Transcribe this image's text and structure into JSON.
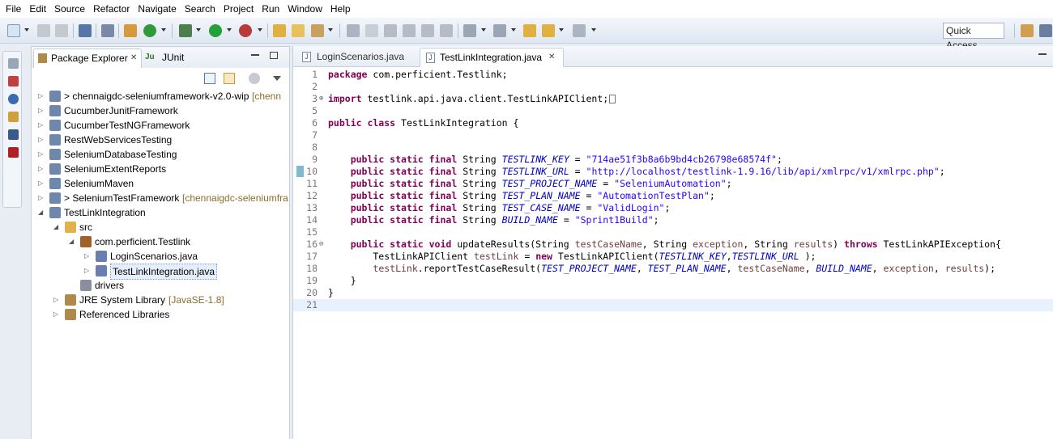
{
  "menu": [
    "File",
    "Edit",
    "Source",
    "Refactor",
    "Navigate",
    "Search",
    "Project",
    "Run",
    "Window",
    "Help"
  ],
  "toolbar": {
    "quick_access": "Quick Access"
  },
  "package_explorer": {
    "tab_label": "Package Explorer",
    "junit_tab_label": "JUnit",
    "tree": [
      {
        "label": "> chennaigdc-seleniumframework-v2.0-wip",
        "decoration": "[chenn",
        "indent": 0,
        "twisty": "closed"
      },
      {
        "label": "CucumberJunitFramework",
        "decoration": "",
        "indent": 0,
        "twisty": "closed"
      },
      {
        "label": "CucumberTestNGFramework",
        "decoration": "",
        "indent": 0,
        "twisty": "closed"
      },
      {
        "label": "RestWebServicesTesting",
        "decoration": "",
        "indent": 0,
        "twisty": "closed"
      },
      {
        "label": "SeleniumDatabaseTesting",
        "decoration": "",
        "indent": 0,
        "twisty": "closed"
      },
      {
        "label": "SeleniumExtentReports",
        "decoration": "",
        "indent": 0,
        "twisty": "closed"
      },
      {
        "label": "SeleniumMaven",
        "decoration": "",
        "indent": 0,
        "twisty": "closed"
      },
      {
        "label": "> SeleniumTestFramework",
        "decoration": "[chennaigdc-seleniumfra",
        "indent": 0,
        "twisty": "closed"
      },
      {
        "label": "TestLinkIntegration",
        "decoration": "",
        "indent": 0,
        "twisty": "open"
      },
      {
        "label": "src",
        "decoration": "",
        "indent": 1,
        "twisty": "open"
      },
      {
        "label": "com.perficient.Testlink",
        "decoration": "",
        "indent": 2,
        "twisty": "open"
      },
      {
        "label": "LoginScenarios.java",
        "decoration": "",
        "indent": 3,
        "twisty": "closed"
      },
      {
        "label": "TestLinkIntegration.java",
        "decoration": "",
        "indent": 3,
        "twisty": "closed"
      },
      {
        "label": "drivers",
        "decoration": "",
        "indent": 2,
        "twisty": "none"
      },
      {
        "label": "JRE System Library",
        "decoration": "[JavaSE-1.8]",
        "indent": 1,
        "twisty": "closed"
      },
      {
        "label": "Referenced Libraries",
        "decoration": "",
        "indent": 1,
        "twisty": "closed"
      }
    ]
  },
  "editor": {
    "tabs": [
      "LoginScenarios.java",
      "TestLinkIntegration.java"
    ],
    "line_numbers": [
      "1",
      "2",
      "3",
      "5",
      "6",
      "7",
      "8",
      "9",
      "10",
      "11",
      "12",
      "13",
      "14",
      "15",
      "16",
      "17",
      "18",
      "19",
      "20",
      "21"
    ],
    "lines": [
      {
        "n": "1",
        "parts": [
          [
            "kw",
            "package"
          ],
          [
            "",
            "com.perficient.Testlink;"
          ]
        ]
      },
      {
        "n": "2",
        "parts": []
      },
      {
        "n": "3",
        "parts": [
          [
            "kw",
            "import"
          ],
          [
            "",
            " testlink.api.java.client.TestLinkAPIClient;"
          ]
        ]
      },
      {
        "n": "5",
        "parts": []
      },
      {
        "n": "6",
        "parts": [
          [
            "kw",
            "public class"
          ],
          [
            "",
            " TestLinkIntegration {"
          ]
        ]
      },
      {
        "n": "7",
        "parts": []
      },
      {
        "n": "8",
        "parts": []
      },
      {
        "n": "9",
        "parts": [
          [
            "",
            "    "
          ],
          [
            "kw",
            "public static final"
          ],
          [
            "",
            " String "
          ],
          [
            "fld",
            "TESTLINK_KEY"
          ],
          [
            "",
            " = "
          ],
          [
            "str",
            "\"714ae51f3b8a6b9bd4cb26798e68574f\""
          ],
          [
            "",
            ";"
          ]
        ]
      },
      {
        "n": "10",
        "parts": [
          [
            "",
            "    "
          ],
          [
            "kw",
            "public static final"
          ],
          [
            "",
            " String "
          ],
          [
            "fld",
            "TESTLINK_URL"
          ],
          [
            "",
            " = "
          ],
          [
            "str",
            "\"http://localhost/testlink-1.9.16/lib/api/xmlrpc/v1/xmlrpc.php\""
          ],
          [
            "",
            ";"
          ]
        ]
      },
      {
        "n": "11",
        "parts": [
          [
            "",
            "    "
          ],
          [
            "kw",
            "public static final"
          ],
          [
            "",
            " String "
          ],
          [
            "fld",
            "TEST_PROJECT_NAME"
          ],
          [
            "",
            " = "
          ],
          [
            "str",
            "\"SeleniumAutomation\""
          ],
          [
            "",
            ";"
          ]
        ]
      },
      {
        "n": "12",
        "parts": [
          [
            "",
            "    "
          ],
          [
            "kw",
            "public static final"
          ],
          [
            "",
            " String "
          ],
          [
            "fld",
            "TEST_PLAN_NAME"
          ],
          [
            "",
            " = "
          ],
          [
            "str",
            "\"AutomationTestPlan\""
          ],
          [
            "",
            ";"
          ]
        ]
      },
      {
        "n": "13",
        "parts": [
          [
            "",
            "    "
          ],
          [
            "kw",
            "public static final"
          ],
          [
            "",
            " String "
          ],
          [
            "fld",
            "TEST_CASE_NAME"
          ],
          [
            "",
            " = "
          ],
          [
            "str",
            "\"ValidLogin\""
          ],
          [
            "",
            ";"
          ]
        ]
      },
      {
        "n": "14",
        "parts": [
          [
            "",
            "    "
          ],
          [
            "kw",
            "public static final"
          ],
          [
            "",
            " String "
          ],
          [
            "fld",
            "BUILD_NAME"
          ],
          [
            "",
            " = "
          ],
          [
            "str",
            "\"Sprint1Build\""
          ],
          [
            "",
            ";"
          ]
        ]
      },
      {
        "n": "15",
        "parts": []
      },
      {
        "n": "16",
        "parts": [
          [
            "",
            "    "
          ],
          [
            "kw",
            "public static void"
          ],
          [
            "",
            " updateResults(String "
          ],
          [
            "lvar",
            "testCaseName"
          ],
          [
            "",
            ", String "
          ],
          [
            "lvar",
            "exception"
          ],
          [
            "",
            ", String "
          ],
          [
            "lvar",
            "results"
          ],
          [
            "",
            ") "
          ],
          [
            "kw",
            "throws"
          ],
          [
            "",
            " TestLinkAPIException{"
          ]
        ]
      },
      {
        "n": "17",
        "parts": [
          [
            "",
            "        TestLinkAPIClient "
          ],
          [
            "lvar",
            "testLink"
          ],
          [
            "",
            " = "
          ],
          [
            "kw",
            "new"
          ],
          [
            "",
            " TestLinkAPIClient("
          ],
          [
            "fld",
            "TESTLINK_KEY"
          ],
          [
            "",
            ","
          ],
          [
            "fld",
            "TESTLINK_URL"
          ],
          [
            "",
            " );"
          ]
        ]
      },
      {
        "n": "18",
        "parts": [
          [
            "",
            "        "
          ],
          [
            "lvar",
            "testLink"
          ],
          [
            "",
            ".reportTestCaseResult("
          ],
          [
            "fld",
            "TEST_PROJECT_NAME"
          ],
          [
            "",
            ", "
          ],
          [
            "fld",
            "TEST_PLAN_NAME"
          ],
          [
            "",
            ", "
          ],
          [
            "lvar",
            "testCaseName"
          ],
          [
            "",
            ", "
          ],
          [
            "fld",
            "BUILD_NAME"
          ],
          [
            "",
            ", "
          ],
          [
            "lvar",
            "exception"
          ],
          [
            "",
            ", "
          ],
          [
            "lvar",
            "results"
          ],
          [
            "",
            ");"
          ]
        ]
      },
      {
        "n": "19",
        "parts": [
          [
            "",
            "    }"
          ]
        ]
      },
      {
        "n": "20",
        "parts": [
          [
            "",
            "}"
          ]
        ]
      },
      {
        "n": "21",
        "parts": []
      }
    ]
  },
  "colors": {
    "keyword": "#7f0055",
    "string": "#2a00ff",
    "field": "#0000c0",
    "local_var": "#6a3e3e",
    "line_number": "#787878",
    "current_line": "#e8f2fe"
  }
}
